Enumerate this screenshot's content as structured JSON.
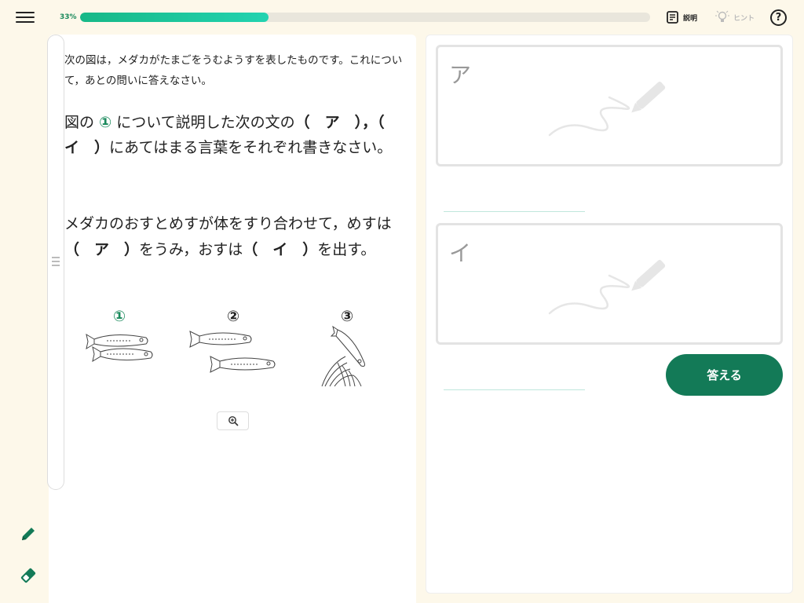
{
  "header": {
    "progress_label": "33%",
    "progress_value": 0.33,
    "explain_label": "説明",
    "hint_label": "ヒント",
    "help_label": "?"
  },
  "question": {
    "intro": "次の図は，メダカがたまごをうむようすを表したものです。これについて，あとの問いに答えなさい。",
    "main_prefix": "図の",
    "main_num": "①",
    "main_mid": "について説明した次の文の",
    "blank_a": "（　ア　），",
    "blank_i_open": "（　イ　）",
    "main_suffix": "にあてはまる言葉をそれぞれ書きなさい。",
    "sentence_1": "メダカのおすとめすが体をすり合わせて，めすは",
    "sentence_blank_a": "（　ア　）",
    "sentence_2": "をうみ，おすは",
    "sentence_blank_i": "（　イ　）",
    "sentence_3": "を出す。"
  },
  "figures": [
    {
      "label": "①"
    },
    {
      "label": "②"
    },
    {
      "label": "③"
    }
  ],
  "answers": {
    "box_a_label": "ア",
    "box_i_label": "イ",
    "submit_label": "答える"
  },
  "colors": {
    "accent": "#137a57",
    "progress": "#17b887",
    "background": "#fdf8ea"
  }
}
